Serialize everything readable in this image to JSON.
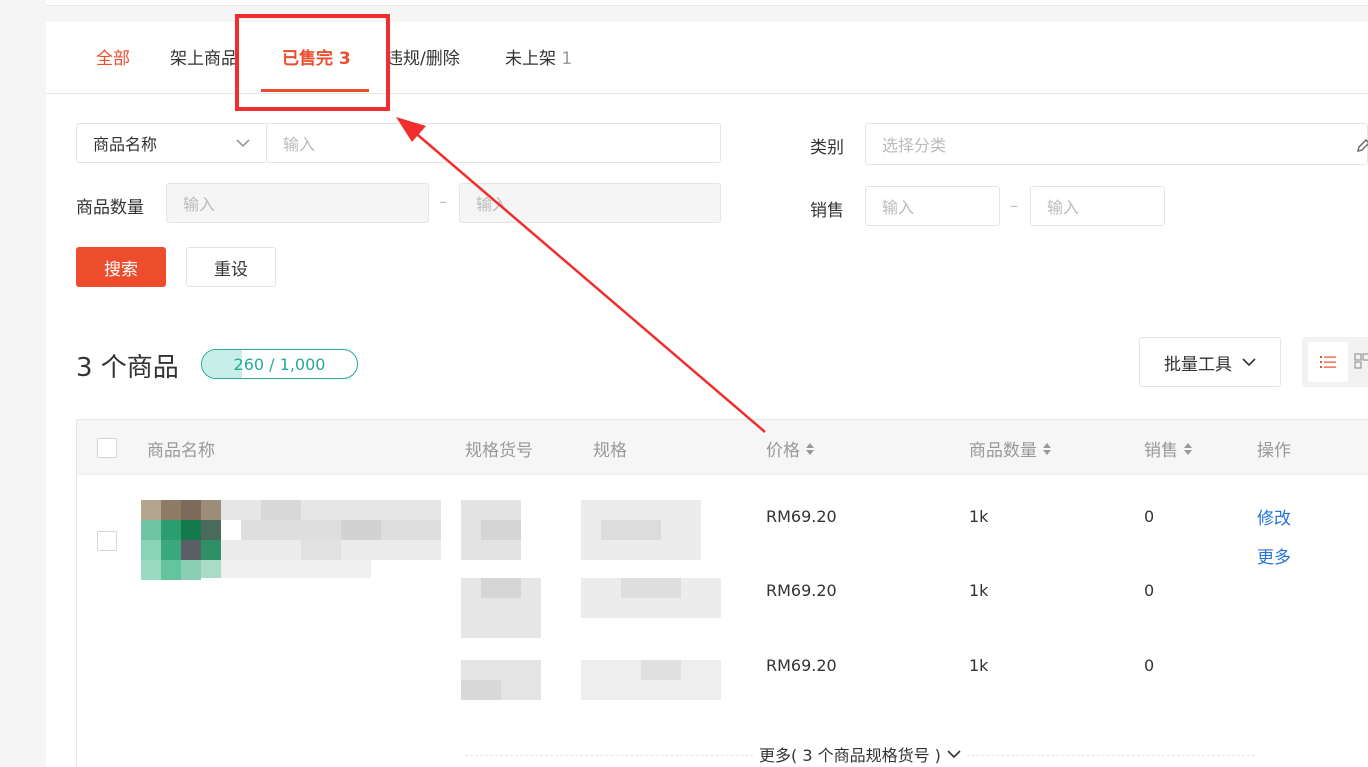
{
  "tabs": [
    {
      "label": "全部",
      "count": ""
    },
    {
      "label": "架上商品",
      "count": ""
    },
    {
      "label": "已售完",
      "count": "3"
    },
    {
      "label": "违规/删除",
      "count": ""
    },
    {
      "label": "未上架",
      "count": "1"
    }
  ],
  "filters": {
    "name_select": "商品名称",
    "name_placeholder": "输入",
    "category_label": "类别",
    "category_placeholder": "选择分类",
    "quantity_label": "商品数量",
    "quantity_min_placeholder": "输入",
    "quantity_max_placeholder": "输入",
    "sales_label": "销售",
    "sales_min_placeholder": "输入",
    "sales_max_placeholder": "输入",
    "range_sep": "–",
    "search_button": "搜索",
    "reset_button": "重设"
  },
  "summary": {
    "count_text": "3 个商品",
    "quota_text": "260 / 1,000",
    "quota_fraction": 0.26,
    "batch_tools": "批量工具"
  },
  "table": {
    "headers": {
      "name": "商品名称",
      "sku": "规格货号",
      "variation": "规格",
      "price": "价格",
      "quantity": "商品数量",
      "sales": "销售",
      "actions": "操作"
    },
    "rows": [
      {
        "price": "RM69.20",
        "quantity": "1k",
        "sales": "0"
      },
      {
        "price": "RM69.20",
        "quantity": "1k",
        "sales": "0"
      },
      {
        "price": "RM69.20",
        "quantity": "1k",
        "sales": "0"
      }
    ],
    "action_edit": "修改",
    "action_more": "更多",
    "expand_text": "更多( 3 个商品规格货号 )"
  },
  "colors": {
    "brand": "#ee4d2d",
    "link": "#2673dd",
    "quota": "#26aa99",
    "annotation": "#f02e2e"
  }
}
